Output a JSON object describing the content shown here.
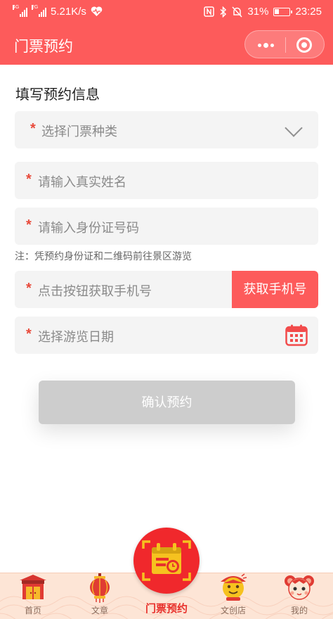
{
  "status_bar": {
    "network_left": "4G",
    "network_right": "2G",
    "speed": "5.21K/s",
    "battery": "31%",
    "time": "23:25"
  },
  "nav": {
    "title": "门票预约"
  },
  "form": {
    "section_title": "填写预约信息",
    "required_mark": "*",
    "ticket_type_placeholder": "选择门票种类",
    "name_placeholder": "请输入真实姓名",
    "id_placeholder": "请输入身份证号码",
    "note": "注：凭预约身份证和二维码前往景区游览",
    "phone_placeholder": "点击按钮获取手机号",
    "get_phone_label": "获取手机号",
    "date_placeholder": "选择游览日期",
    "confirm_label": "确认预约"
  },
  "tabbar": {
    "items": [
      {
        "label": "首页",
        "icon": "gate-icon"
      },
      {
        "label": "文章",
        "icon": "lantern-icon"
      },
      {
        "label": "门票预约",
        "icon": "calendar-ticket-icon",
        "active": true
      },
      {
        "label": "文创店",
        "icon": "shop-mascot-icon"
      },
      {
        "label": "我的",
        "icon": "mouse-mascot-icon"
      }
    ]
  },
  "colors": {
    "brand": "#fd5b5b",
    "required": "#e84a3b",
    "confirm_disabled": "#cdcdcd",
    "tab_active": "#e8302b"
  }
}
